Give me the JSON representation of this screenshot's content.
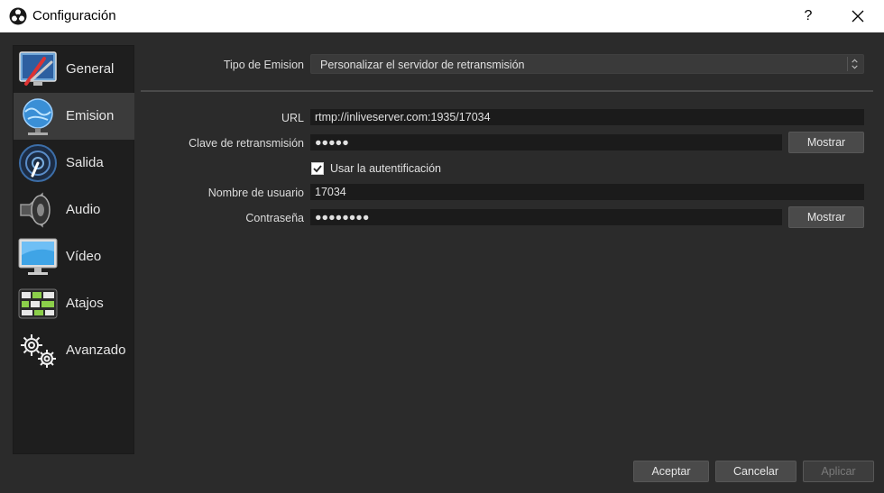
{
  "window": {
    "title": "Configuración",
    "help_label": "?"
  },
  "sidebar": {
    "items": [
      {
        "label": "General",
        "icon": "general-icon"
      },
      {
        "label": "Emision",
        "icon": "emision-icon",
        "active": true
      },
      {
        "label": "Salida",
        "icon": "salida-icon"
      },
      {
        "label": "Audio",
        "icon": "audio-icon"
      },
      {
        "label": "Vídeo",
        "icon": "video-icon"
      },
      {
        "label": "Atajos",
        "icon": "atajos-icon"
      },
      {
        "label": "Avanzado",
        "icon": "avanzado-icon"
      }
    ]
  },
  "stream": {
    "type_label": "Tipo de Emision",
    "type_value": "Personalizar el servidor de retransmisión",
    "url_label": "URL",
    "url_value": "rtmp://inliveserver.com:1935/17034",
    "key_label": "Clave de retransmisión",
    "key_value": "●●●●●",
    "show_key_button": "Mostrar",
    "auth_checkbox_label": "Usar la autentificación",
    "auth_checked": true,
    "username_label": "Nombre de usuario",
    "username_value": "17034",
    "password_label": "Contraseña",
    "password_value": "●●●●●●●●",
    "show_password_button": "Mostrar"
  },
  "footer": {
    "accept": "Aceptar",
    "cancel": "Cancelar",
    "apply": "Aplicar"
  },
  "colors": {
    "background": "#2b2b2b",
    "sidebar": "#1e1e1e",
    "field": "#1b1b1b",
    "button": "#4a4a4a"
  }
}
